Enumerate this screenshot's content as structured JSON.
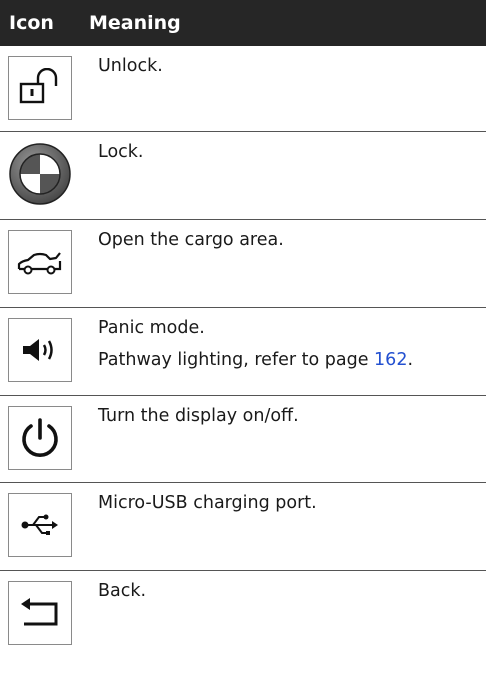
{
  "header": {
    "icon_label": "Icon",
    "meaning_label": "Meaning"
  },
  "rows": [
    {
      "icon": "unlock-icon",
      "lines": [
        "Unlock."
      ]
    },
    {
      "icon": "bmw-logo-lock-icon",
      "lines": [
        "Lock."
      ]
    },
    {
      "icon": "car-trunk-open-icon",
      "lines": [
        "Open the cargo area."
      ]
    },
    {
      "icon": "speaker-panic-icon",
      "lines": [
        "Panic mode."
      ],
      "line2_prefix": "Pathway lighting, refer to page ",
      "line2_link": "162",
      "line2_suffix": "."
    },
    {
      "icon": "power-icon",
      "lines": [
        "Turn the display on/off."
      ]
    },
    {
      "icon": "usb-icon",
      "lines": [
        "Micro-USB charging port."
      ]
    },
    {
      "icon": "back-arrow-icon",
      "lines": [
        "Back."
      ]
    }
  ],
  "colors": {
    "header_bg": "#262626",
    "link": "#2350d0"
  }
}
